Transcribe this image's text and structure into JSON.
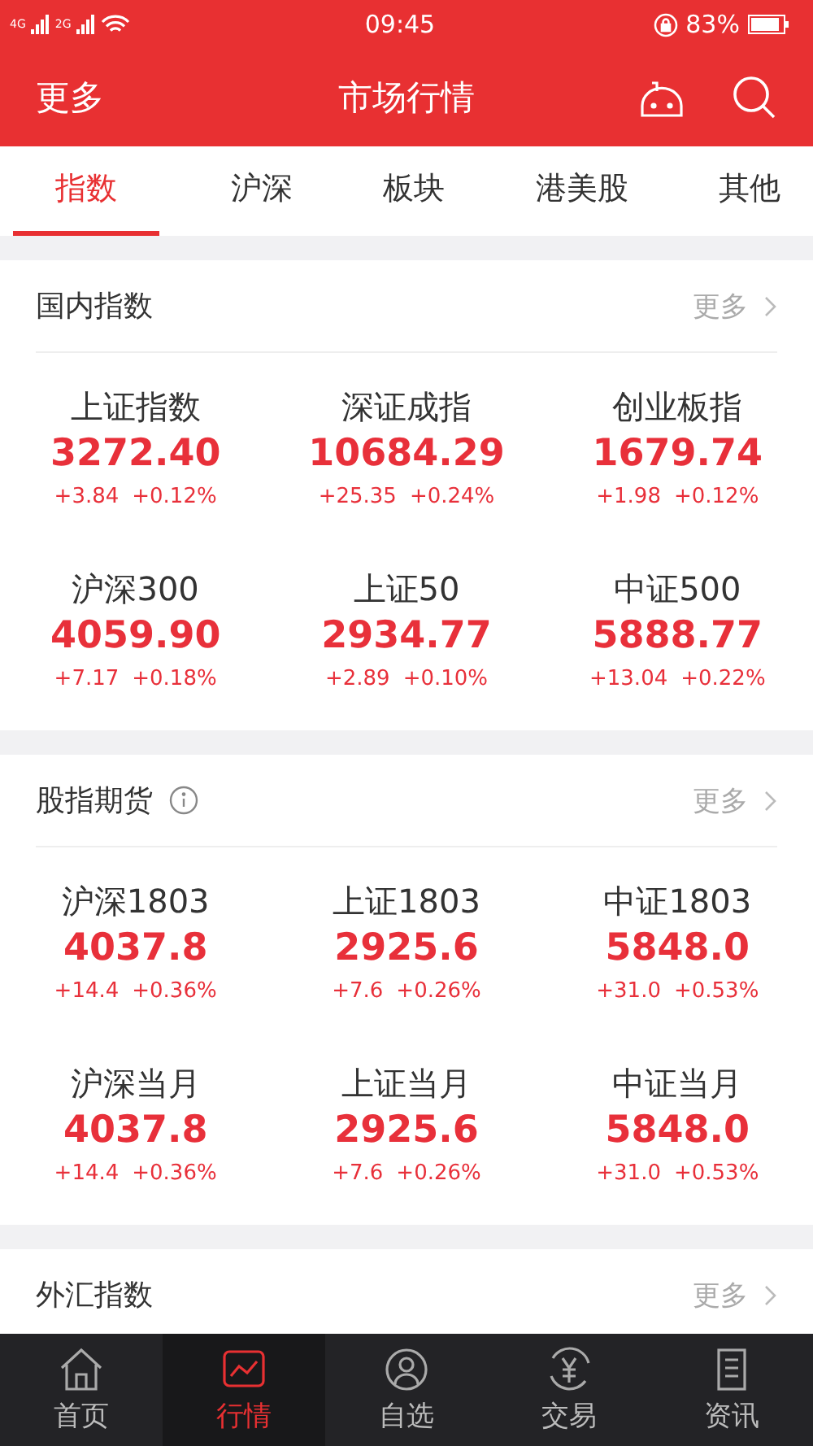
{
  "status_bar": {
    "network_1": "4G",
    "network_2": "2G",
    "time": "09:45",
    "battery": "83%"
  },
  "header": {
    "left": "更多",
    "title": "市场行情"
  },
  "tabs": [
    {
      "label": "指数",
      "selected": true
    },
    {
      "label": "沪深",
      "selected": false
    },
    {
      "label": "板块",
      "selected": false
    },
    {
      "label": "港美股",
      "selected": false
    },
    {
      "label": "其他",
      "selected": false
    }
  ],
  "sections": [
    {
      "title": "国内指数",
      "info": false,
      "more": "更多",
      "items": [
        {
          "name": "上证指数",
          "value": "3272.40",
          "change": "+3.84",
          "pct": "+0.12%"
        },
        {
          "name": "深证成指",
          "value": "10684.29",
          "change": "+25.35",
          "pct": "+0.24%"
        },
        {
          "name": "创业板指",
          "value": "1679.74",
          "change": "+1.98",
          "pct": "+0.12%"
        },
        {
          "name": "沪深300",
          "value": "4059.90",
          "change": "+7.17",
          "pct": "+0.18%"
        },
        {
          "name": "上证50",
          "value": "2934.77",
          "change": "+2.89",
          "pct": "+0.10%"
        },
        {
          "name": "中证500",
          "value": "5888.77",
          "change": "+13.04",
          "pct": "+0.22%"
        }
      ]
    },
    {
      "title": "股指期货",
      "info": true,
      "more": "更多",
      "items": [
        {
          "name": "沪深1803",
          "value": "4037.8",
          "change": "+14.4",
          "pct": "+0.36%"
        },
        {
          "name": "上证1803",
          "value": "2925.6",
          "change": "+7.6",
          "pct": "+0.26%"
        },
        {
          "name": "中证1803",
          "value": "5848.0",
          "change": "+31.0",
          "pct": "+0.53%"
        },
        {
          "name": "沪深当月",
          "value": "4037.8",
          "change": "+14.4",
          "pct": "+0.36%"
        },
        {
          "name": "上证当月",
          "value": "2925.6",
          "change": "+7.6",
          "pct": "+0.26%"
        },
        {
          "name": "中证当月",
          "value": "5848.0",
          "change": "+31.0",
          "pct": "+0.53%"
        }
      ]
    },
    {
      "title": "外汇指数",
      "info": false,
      "more": "更多"
    }
  ],
  "nav": [
    {
      "label": "首页",
      "selected": false
    },
    {
      "label": "行情",
      "selected": true
    },
    {
      "label": "自选",
      "selected": false
    },
    {
      "label": "交易",
      "selected": false
    },
    {
      "label": "资讯",
      "selected": false
    }
  ]
}
